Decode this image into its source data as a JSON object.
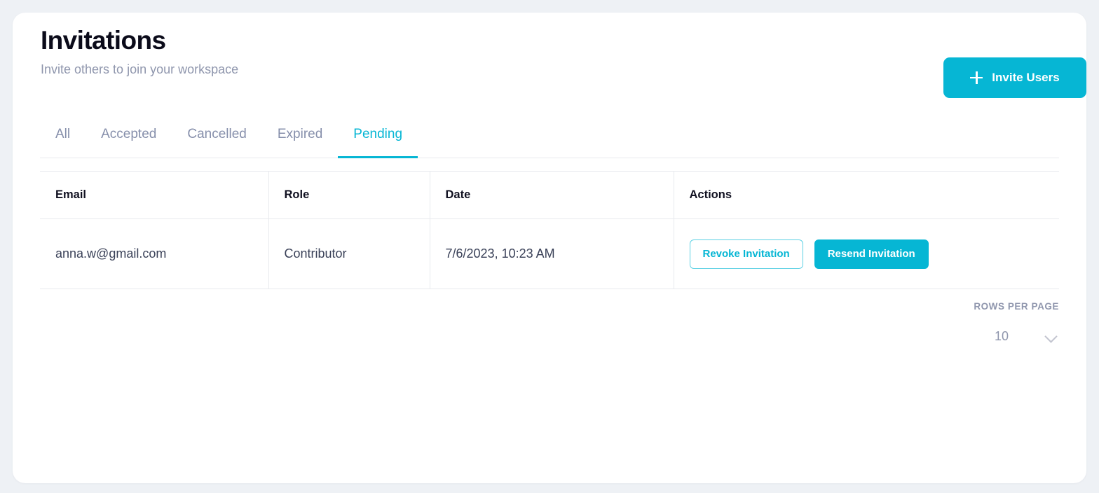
{
  "header": {
    "title": "Invitations",
    "subtitle": "Invite others to join your workspace",
    "invite_button": "Invite Users",
    "plus_icon": "plus-icon"
  },
  "tabs": [
    {
      "label": "All",
      "active": false
    },
    {
      "label": "Accepted",
      "active": false
    },
    {
      "label": "Cancelled",
      "active": false
    },
    {
      "label": "Expired",
      "active": false
    },
    {
      "label": "Pending",
      "active": true
    }
  ],
  "table": {
    "columns": [
      "Email",
      "Role",
      "Date",
      "Actions"
    ],
    "rows": [
      {
        "email": "anna.w@gmail.com",
        "role": "Contributor",
        "date": "7/6/2023, 10:23 AM",
        "actions": {
          "revoke": "Revoke Invitation",
          "resend": "Resend Invitation"
        }
      }
    ]
  },
  "pagination": {
    "rows_per_page_label": "ROWS PER PAGE",
    "rows_per_page_value": "10",
    "chevron_icon": "chevron-down-icon"
  },
  "colors": {
    "accent": "#06b6d4",
    "page_background": "#eef1f5",
    "card_background": "#ffffff",
    "title": "#0b0b1a",
    "muted_text": "#8f96ad",
    "border": "#e8eaee"
  }
}
